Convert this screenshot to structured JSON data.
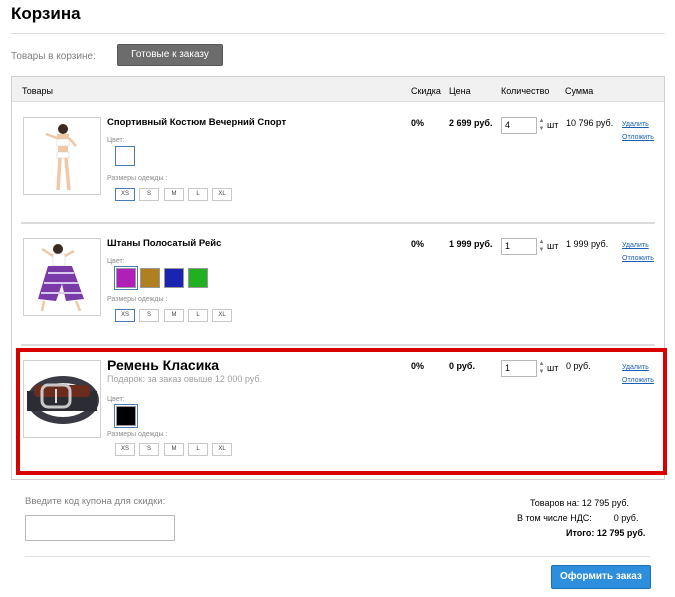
{
  "page": {
    "title": "Корзина",
    "cart_label": "Товары в корзине:",
    "ready_button": "Готовые к заказу"
  },
  "table": {
    "headers": {
      "products": "Товары",
      "discount": "Скидка",
      "price": "Цена",
      "quantity": "Количество",
      "sum": "Сумма"
    }
  },
  "labels": {
    "color": "Цвет:",
    "sizes": "Размеры одежды :",
    "unit": "шт",
    "delete": "Удалить",
    "postpone": "Отложить"
  },
  "sizes": [
    "XS",
    "S",
    "M",
    "L",
    "XL"
  ],
  "items": [
    {
      "name": "Спортивный Костюм Вечерний Спорт",
      "discount": "0%",
      "price": "2 699 руб.",
      "quantity": "4",
      "sum": "10 796 руб.",
      "selected_size": "XS",
      "colors": [
        "#ffffff"
      ]
    },
    {
      "name": "Штаны Полосатый Рейс",
      "discount": "0%",
      "price": "1 999 руб.",
      "quantity": "1",
      "sum": "1 999 руб.",
      "selected_size": "XS",
      "colors": [
        "#b020b8",
        "#b08020",
        "#1a24b0",
        "#20b020"
      ]
    },
    {
      "name": "Ремень Класика",
      "gift_note": "Подарок: за заказ овыше 12 000 руб.",
      "discount": "0%",
      "price": "0 руб.",
      "quantity": "1",
      "sum": "0 руб.",
      "selected_size": "",
      "colors": [
        "#000000"
      ]
    }
  ],
  "coupon": {
    "label": "Введите код купона для скидки:",
    "value": ""
  },
  "totals": {
    "goods_label": "Товаров на:",
    "goods_value": "12 795 руб.",
    "vat_label": "В том числе НДС:",
    "vat_value": "0 руб.",
    "total_label": "Итого:",
    "total_value": "12 795 руб."
  },
  "checkout_button": "Оформить заказ",
  "colors": {
    "accent": "#2e8ede",
    "highlight": "#d90000",
    "link": "#1a5fb4"
  }
}
